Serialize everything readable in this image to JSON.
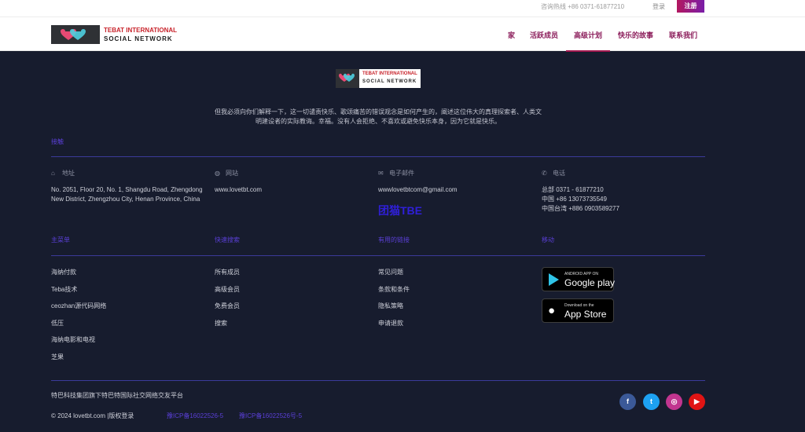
{
  "topbar": {
    "hotline": "咨询热线 +86 0371-61877210",
    "login": "登录",
    "register": "注册"
  },
  "brand": {
    "line1": "TEBAT INTERNATIONAL",
    "line2": "SOCIAL NETWORK"
  },
  "nav": {
    "items": [
      {
        "label": "家"
      },
      {
        "label": "活跃成员"
      },
      {
        "label": "高级计划"
      },
      {
        "label": "快乐的故事"
      },
      {
        "label": "联系我们"
      }
    ],
    "active": "高级计划"
  },
  "footer": {
    "about": "但我必须向你们解释一下，这一切谴责快乐、歌颂痛苦的错误观念是如何产生的，阐述这位伟大的真理探索者、人类文明建设者的实际教诲。幸福。没有人会拒绝、不喜欢或避免快乐本身，因为它就是快乐。",
    "contact_link": "接触",
    "address": {
      "heading": "地址",
      "line1": "No. 2051, Floor 20, No. 1, Shangdu Road, Zhengdong",
      "line2": "New District, Zhengzhou City, Henan Province, China"
    },
    "website": {
      "heading": "网站",
      "value": "www.lovetbt.com"
    },
    "email": {
      "heading": "电子邮件",
      "value": "wwwlovetbtcom@gmail.com",
      "brand_link": "团猫TBE"
    },
    "phone": {
      "heading": "电话",
      "line1": "总部 0371 - 61877210",
      "line2": "中国 +86 13073735549",
      "line3": "中国台湾 +886 0903589277"
    },
    "columns": {
      "main_menu": {
        "heading": "主菜单",
        "items": [
          "海纳付款",
          "Teba技术",
          "ceozhan源代码网络",
          "低压",
          "海纳电影和电视",
          "芝果"
        ]
      },
      "quick_search": {
        "heading": "快速搜索",
        "items": [
          "所有成员",
          "高级会员",
          "免费会员",
          "搜索"
        ]
      },
      "useful_links": {
        "heading": "有用的链接",
        "items": [
          "常见问题",
          "条款和条件",
          "隐私策略",
          "申请退款"
        ]
      },
      "mobile": {
        "heading": "移动",
        "google_play_small": "ANDROID APP ON",
        "google_play_big": "Google play",
        "app_store_small": "Download on the",
        "app_store_big": "App Store"
      }
    },
    "company": "特巴科技集团旗下特巴特国际社交网络交友平台",
    "copyright": "© 2024 lovetbt.com |版权登录",
    "icp1": "豫ICP备16022526-5",
    "icp2": "豫ICP备16022526号-5",
    "social": [
      {
        "name": "facebook",
        "glyph": "f",
        "color": "#3b5998"
      },
      {
        "name": "twitter",
        "glyph": "t",
        "color": "#1da1f2"
      },
      {
        "name": "instagram",
        "glyph": "◎",
        "color": "#c1358f"
      },
      {
        "name": "youtube",
        "glyph": "▶",
        "color": "#e01414"
      }
    ]
  }
}
